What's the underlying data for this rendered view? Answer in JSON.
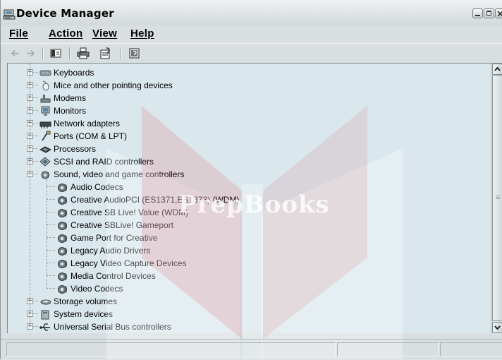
{
  "window": {
    "title": "Device Manager",
    "icon": "computer-icon"
  },
  "menu": {
    "items": [
      {
        "label": "File"
      },
      {
        "label": "Action"
      },
      {
        "label": "View"
      },
      {
        "label": "Help"
      }
    ]
  },
  "toolbar": {
    "buttons": [
      {
        "icon": "back-arrow-icon"
      },
      {
        "icon": "forward-arrow-icon"
      },
      {
        "icon": "show-hide-console-tree-icon"
      },
      {
        "icon": "print-icon"
      },
      {
        "icon": "properties-icon"
      },
      {
        "icon": "help-icon"
      }
    ]
  },
  "tree": {
    "categories": [
      {
        "label": "Keyboards",
        "icon": "keyboard-icon",
        "expanded": false
      },
      {
        "label": "Mice and other pointing devices",
        "icon": "mouse-icon",
        "expanded": false
      },
      {
        "label": "Modems",
        "icon": "modem-icon",
        "expanded": false
      },
      {
        "label": "Monitors",
        "icon": "monitor-icon",
        "expanded": false
      },
      {
        "label": "Network adapters",
        "icon": "network-adapter-icon",
        "expanded": false
      },
      {
        "label": "Ports (COM & LPT)",
        "icon": "port-icon",
        "expanded": false
      },
      {
        "label": "Processors",
        "icon": "processor-icon",
        "expanded": false
      },
      {
        "label": "SCSI and RAID controllers",
        "icon": "scsi-icon",
        "expanded": false
      },
      {
        "label": "Sound, video and game controllers",
        "icon": "sound-icon",
        "expanded": true
      }
    ],
    "sound_children": [
      {
        "label": "Audio Codecs",
        "icon": "sound-device-icon"
      },
      {
        "label": "Creative AudioPCI (ES1371,ES1373) (WDM)",
        "icon": "sound-device-icon"
      },
      {
        "label": "Creative SB Live! Value (WDM)",
        "icon": "sound-device-icon"
      },
      {
        "label": "Creative SBLive! Gameport",
        "icon": "sound-device-icon"
      },
      {
        "label": "Game Port for Creative",
        "icon": "sound-device-icon"
      },
      {
        "label": "Legacy Audio Drivers",
        "icon": "sound-device-icon"
      },
      {
        "label": "Legacy Video Capture Devices",
        "icon": "sound-device-icon"
      },
      {
        "label": "Media Control Devices",
        "icon": "sound-device-icon"
      },
      {
        "label": "Video Codecs",
        "icon": "sound-device-icon"
      }
    ],
    "after": [
      {
        "label": "Storage volumes",
        "icon": "storage-icon",
        "expanded": false
      },
      {
        "label": "System devices",
        "icon": "system-device-icon",
        "expanded": false
      },
      {
        "label": "Universal Serial Bus controllers",
        "icon": "usb-icon",
        "expanded": false
      }
    ]
  },
  "watermark": {
    "text": "PrepBooks"
  },
  "colors": {
    "pane_background": "#dae7ec",
    "window_background": "#d9dfe0",
    "watermark_accent": "#d84a53",
    "watermark_light": "#ffffff"
  }
}
